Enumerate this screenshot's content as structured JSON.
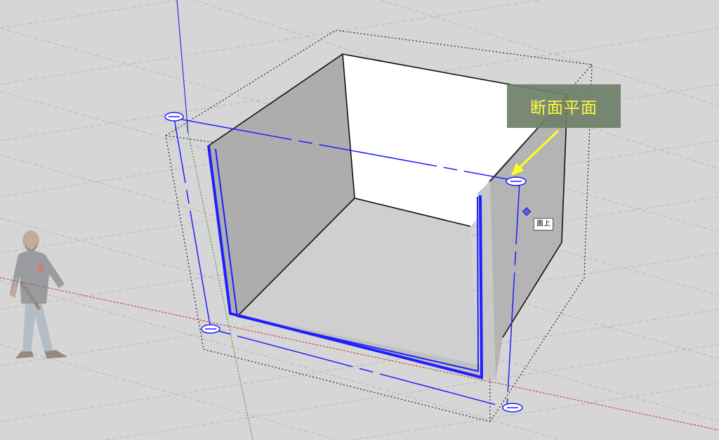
{
  "callout": {
    "label": "断面平面",
    "text_color": "#ffff33",
    "background": "#6f8068"
  },
  "tooltip": {
    "label": "面上"
  },
  "colors": {
    "background": "#d6d6d6",
    "section_blue": "#1f1fff",
    "green_axis": "#2f8f2f",
    "red_axis": "#c0392b",
    "blue_axis": "#3030e0"
  },
  "icons": {
    "section_grip": "section-grip-icon",
    "inference_point": "inference-point-icon",
    "callout_arrow": "arrow-icon",
    "scale_figure": "person-figure"
  }
}
